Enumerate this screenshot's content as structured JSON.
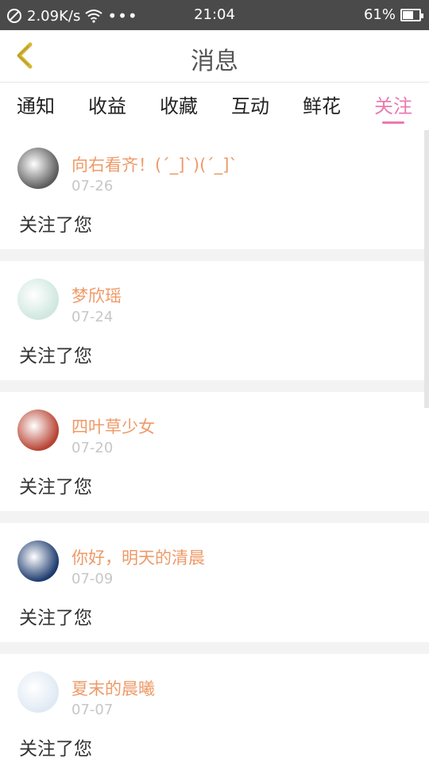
{
  "status_bar": {
    "speed": "2.09K/s",
    "time": "21:04",
    "battery": "61%",
    "battery_level": 0.61
  },
  "header": {
    "title": "消息"
  },
  "tabs": [
    {
      "label": "通知"
    },
    {
      "label": "收益"
    },
    {
      "label": "收藏"
    },
    {
      "label": "互动"
    },
    {
      "label": "鲜花"
    },
    {
      "label": "关注",
      "active": true
    }
  ],
  "items": [
    {
      "name": "向右看齐！(´_]`)(´_]`",
      "date": "07-26",
      "message": "关注了您",
      "avatar_color": "#5c5c5c"
    },
    {
      "name": "梦欣瑶",
      "date": "07-24",
      "message": "关注了您",
      "avatar_color": "#cfe7e0"
    },
    {
      "name": "四叶草少女",
      "date": "07-20",
      "message": "关注了您",
      "avatar_color": "#b74232"
    },
    {
      "name": "你好，明天的清晨",
      "date": "07-09",
      "message": "关注了您",
      "avatar_color": "#1d3b6e"
    },
    {
      "name": "夏末的晨曦",
      "date": "07-07",
      "message": "关注了您",
      "avatar_color": "#dfe9f3"
    }
  ]
}
